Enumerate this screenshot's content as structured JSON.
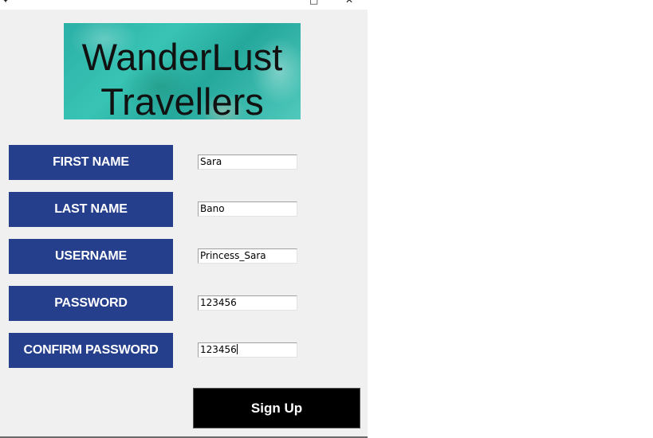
{
  "banner": {
    "line1": "WanderLust",
    "line2": "Travellers"
  },
  "form": {
    "fields": [
      {
        "label": "FIRST NAME",
        "value": "Sara"
      },
      {
        "label": "LAST NAME",
        "value": "Bano"
      },
      {
        "label": "USERNAME",
        "value": "Princess_Sara"
      },
      {
        "label": "PASSWORD",
        "value": "123456"
      },
      {
        "label": "CONFIRM PASSWORD",
        "value": "123456"
      }
    ],
    "submit_label": "Sign Up"
  },
  "colors": {
    "label_bg": "#253f8c",
    "button_bg": "#000000",
    "window_bg": "#f0f0f0"
  }
}
